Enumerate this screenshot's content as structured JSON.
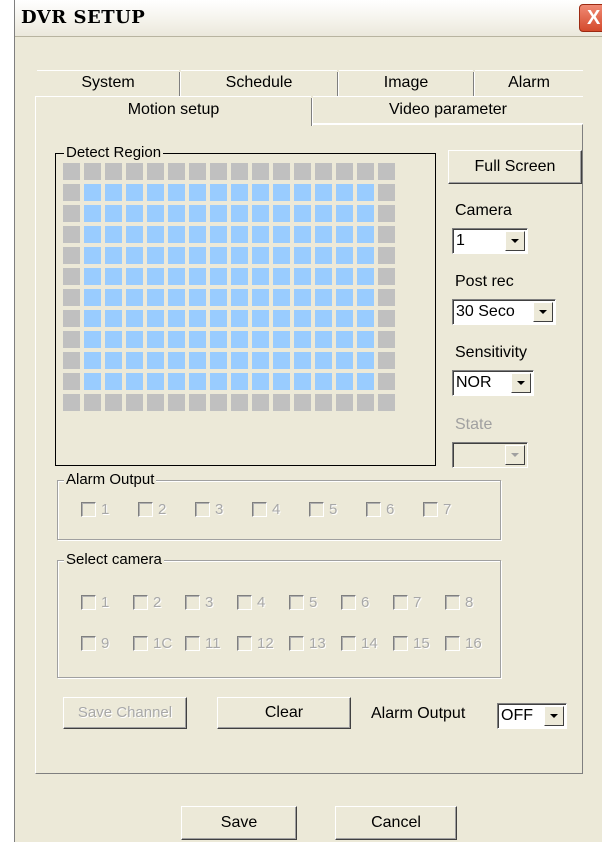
{
  "window": {
    "title": "DVR SETUP",
    "close_glyph": "X"
  },
  "tabs_top": [
    {
      "label": "System"
    },
    {
      "label": "Schedule"
    },
    {
      "label": "Image"
    },
    {
      "label": "Alarm"
    }
  ],
  "tabs_bottom": [
    {
      "label": "Motion setup",
      "active": true
    },
    {
      "label": "Video parameter",
      "active": false
    }
  ],
  "detect_region": {
    "label": "Detect Region",
    "rows": 12,
    "cols": 16,
    "active_rows": [
      1,
      10
    ],
    "active_cols": [
      1,
      14
    ],
    "active_color": "#99ccff",
    "inactive_color": "#c0c0c0"
  },
  "full_screen_button": "Full Screen",
  "camera": {
    "label": "Camera",
    "value": "1"
  },
  "post_rec": {
    "label": "Post rec",
    "value": "30 Seco"
  },
  "sensitivity": {
    "label": "Sensitivity",
    "value": "NOR"
  },
  "state": {
    "label": "State",
    "value": ""
  },
  "alarm_output_group": {
    "label": "Alarm Output",
    "items": [
      "1",
      "2",
      "3",
      "4",
      "5",
      "6",
      "7"
    ]
  },
  "select_camera_group": {
    "label": "Select camera",
    "row1": [
      "1",
      "2",
      "3",
      "4",
      "5",
      "6",
      "7",
      "8"
    ],
    "row2": [
      "9",
      "1C",
      "11",
      "12",
      "13",
      "14",
      "15",
      "16"
    ]
  },
  "save_channel_button": "Save Channel",
  "clear_button": "Clear",
  "alarm_output_select": {
    "label": "Alarm Output",
    "value": "OFF"
  },
  "save_button": "Save",
  "cancel_button": "Cancel"
}
